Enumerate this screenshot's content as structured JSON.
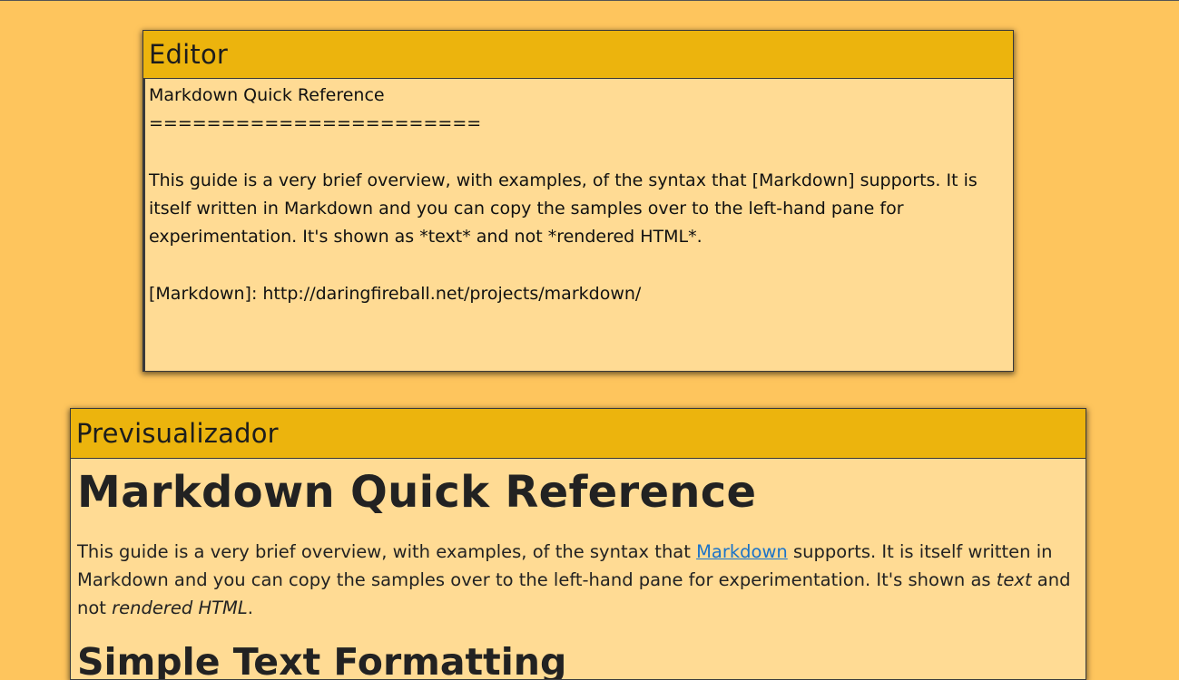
{
  "editor": {
    "title": "Editor",
    "content": "Markdown Quick Reference\n=======================\n\nThis guide is a very brief overview, with examples, of the syntax that [Markdown] supports. It is itself written in Markdown and you can copy the samples over to the left-hand pane for experimentation. It's shown as *text* and not *rendered HTML*.\n\n[Markdown]: http://daringfireball.net/projects/markdown/\n"
  },
  "preview": {
    "title": "Previsualizador",
    "heading": "Markdown Quick Reference",
    "paragraph": {
      "before_link": "This guide is a very brief overview, with examples, of the syntax that ",
      "link_text": "Markdown",
      "link_href": "http://daringfireball.net/projects/markdown/",
      "after_link": " supports. It is itself written in Markdown and you can copy the samples over to the left-hand pane for experimentation. It's shown as ",
      "em1": "text",
      "middle": " and not ",
      "em2": "rendered HTML",
      "end": "."
    },
    "subheading": "Simple Text Formatting"
  },
  "colors": {
    "page_background": "#fec55d",
    "header_background": "#ecb40d",
    "pane_background": "#ffdb94",
    "link": "#1a73c9"
  }
}
